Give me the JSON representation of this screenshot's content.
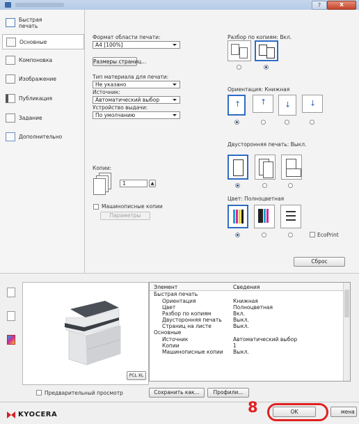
{
  "window": {
    "title": "",
    "close_label": "x",
    "help_label": "?"
  },
  "sidebar": {
    "items": [
      {
        "label": "Быстрая\nпечать",
        "icon": "quick-print-icon"
      },
      {
        "label": "Основные",
        "icon": "basic-icon"
      },
      {
        "label": "Компоновка",
        "icon": "layout-icon"
      },
      {
        "label": "Изображение",
        "icon": "image-icon"
      },
      {
        "label": "Публикация",
        "icon": "publishing-icon"
      },
      {
        "label": "Задание",
        "icon": "job-icon"
      },
      {
        "label": "Дополнительно",
        "icon": "advanced-icon"
      }
    ],
    "active_index": 1
  },
  "settings": {
    "print_size_label": "Формат области печати:",
    "print_size_value": "A4 [100%]",
    "page_size_button": "Размеры страниц...",
    "media_type_label": "Тип материала для печати:",
    "media_type_value": "Не указано",
    "source_label": "Источник:",
    "source_value": "Автоматический выбор",
    "output_label": "Устройство выдачи:",
    "output_value": "По умолчанию",
    "copies_label": "Копии:",
    "copies_value": "1",
    "collate_label": "Машинописные копии",
    "params_button": "Параметры",
    "collate_section_label": "Разбор по копиям:  Вкл.",
    "orientation_label": "Ориентация:  Книжная",
    "duplex_label": "Двусторонняя печать:  Выкл.",
    "color_label": "Цвет:  Полноцветная",
    "ecoprint_label": "EcoPrint",
    "reset_button": "Сброс"
  },
  "properties": {
    "col_element": "Элемент",
    "col_details": "Сведения",
    "rows": [
      {
        "key": "Быстрая печать",
        "value": "",
        "group": true
      },
      {
        "key": "Ориентация",
        "value": "Книжная",
        "group": false
      },
      {
        "key": "Цвет",
        "value": "Полноцветная",
        "group": false
      },
      {
        "key": "Разбор по копиям",
        "value": "Вкл.",
        "group": false
      },
      {
        "key": "Двусторонняя печать",
        "value": "Выкл.",
        "group": false
      },
      {
        "key": "Страниц на листе",
        "value": "Выкл.",
        "group": false
      },
      {
        "key": "Основные",
        "value": "",
        "group": true
      },
      {
        "key": "Источник",
        "value": "Автоматический выбор",
        "group": false
      },
      {
        "key": "Копии",
        "value": "1",
        "group": false
      },
      {
        "key": "Машинописные копии",
        "value": "Выкл.",
        "group": false
      }
    ]
  },
  "bottom": {
    "pcl_label": "PCL XL",
    "preview_checkbox_label": "Предварительный просмотр",
    "save_as_button": "Сохранить как...",
    "profiles_button": "Профили...",
    "ok_button": "OK",
    "cancel_button": "мена",
    "step_number": "8",
    "annotation_color": "#e02020",
    "brand": "KYOCERA",
    "brand_color": "#d4202a"
  }
}
